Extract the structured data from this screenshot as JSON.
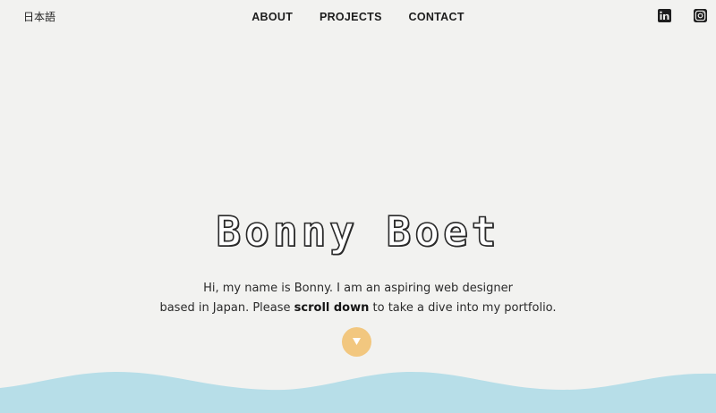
{
  "header": {
    "language_label": "日本語",
    "nav": [
      {
        "label": "ABOUT"
      },
      {
        "label": "PROJECTS"
      },
      {
        "label": "CONTACT"
      }
    ],
    "social_icons": [
      "linkedin-icon",
      "instagram-icon"
    ]
  },
  "hero": {
    "title": "Bonny Boet",
    "intro_line1": "Hi, my name is Bonny. I am an aspiring web designer",
    "intro_line2_before": "based in Japan. Please ",
    "intro_line2_bold": "scroll down",
    "intro_line2_after": " to take a dive into my portfolio.",
    "scroll_icon": "arrow-down-icon"
  },
  "colors": {
    "background": "#f2f2f0",
    "accent": "#f2c77f",
    "wave": "#b7dee8",
    "text": "#222222"
  }
}
